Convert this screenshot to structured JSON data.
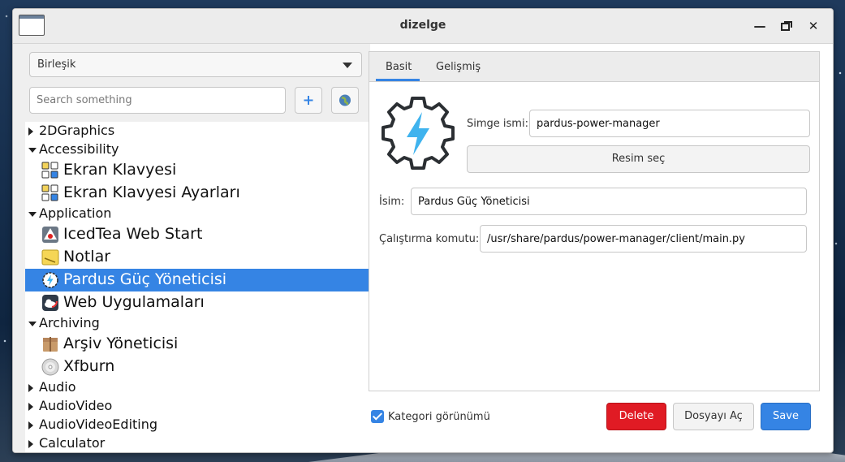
{
  "window": {
    "title": "dizelge"
  },
  "sidebar": {
    "category_combo": "Birleşik",
    "search_placeholder": "Search something",
    "tree": [
      {
        "type": "category",
        "label": "2DGraphics",
        "expanded": false
      },
      {
        "type": "category",
        "label": "Accessibility",
        "expanded": true
      },
      {
        "type": "app",
        "label": "Ekran Klavyesi",
        "icon": "keyboard-icon"
      },
      {
        "type": "app",
        "label": "Ekran Klavyesi Ayarları",
        "icon": "keyboard-icon"
      },
      {
        "type": "category",
        "label": "Application",
        "expanded": true
      },
      {
        "type": "app",
        "label": "IcedTea Web Start",
        "icon": "java-icon"
      },
      {
        "type": "app",
        "label": "Notlar",
        "icon": "notes-icon"
      },
      {
        "type": "app",
        "label": "Pardus Güç Yöneticisi",
        "icon": "power-gear-icon",
        "selected": true
      },
      {
        "type": "app",
        "label": "Web Uygulamaları",
        "icon": "cloud-icon"
      },
      {
        "type": "category",
        "label": "Archiving",
        "expanded": true
      },
      {
        "type": "app",
        "label": "Arşiv Yöneticisi",
        "icon": "archive-box-icon"
      },
      {
        "type": "app",
        "label": "Xfburn",
        "icon": "disc-icon"
      },
      {
        "type": "category",
        "label": "Audio",
        "expanded": false
      },
      {
        "type": "category",
        "label": "AudioVideo",
        "expanded": false
      },
      {
        "type": "category",
        "label": "AudioVideoEditing",
        "expanded": false
      },
      {
        "type": "category",
        "label": "Calculator",
        "expanded": false
      }
    ]
  },
  "panel": {
    "tabs": [
      "Basit",
      "Gelişmiş"
    ],
    "active_tab": "Basit",
    "icon_name_label": "Simge ismi:",
    "icon_name_value": "pardus-power-manager",
    "choose_image_button": "Resim seç",
    "name_label": "İsim:",
    "name_value": "Pardus Güç Yöneticisi",
    "exec_label": "Çalıştırma komutu:",
    "exec_value": "/usr/share/pardus/power-manager/client/main.py"
  },
  "footer": {
    "category_view_label": "Kategori görünümü",
    "category_view_checked": true,
    "delete_button": "Delete",
    "open_file_button": "Dosyayı Aç",
    "save_button": "Save"
  },
  "colors": {
    "accent": "#3584e4",
    "danger": "#e01b24",
    "bolt": "#3fb3ee"
  }
}
